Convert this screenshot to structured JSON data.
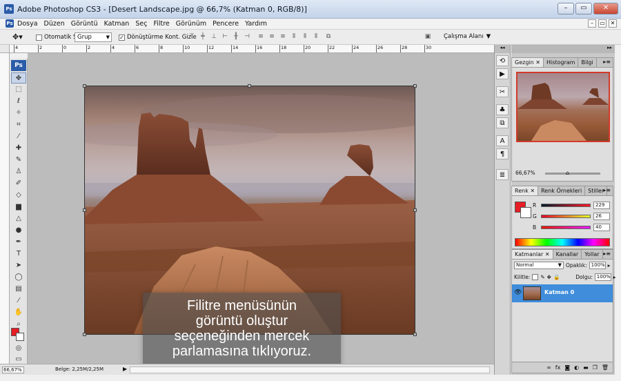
{
  "window": {
    "title": "Adobe Photoshop CS3 - [Desert Landscape.jpg @ 66,7% (Katman 0, RGB/8)]",
    "app_logo": "Ps"
  },
  "menu": [
    "Dosya",
    "Düzen",
    "Görüntü",
    "Katman",
    "Seç",
    "Filtre",
    "Görünüm",
    "Pencere",
    "Yardım"
  ],
  "options": {
    "auto_select_label": "Otomatik Seç:",
    "auto_select_value": "Grup",
    "transform_label": "Dönüştürme Kont. Gizle",
    "workspace_label": "Çalışma Alanı"
  },
  "ruler": [
    "4",
    "2",
    "0",
    "2",
    "4",
    "6",
    "8",
    "10",
    "12",
    "14",
    "16",
    "18",
    "20",
    "22",
    "24",
    "26",
    "28",
    "30"
  ],
  "status": {
    "zoom": "66,67%",
    "doc_size": "Belge: 2,25M/2,25M"
  },
  "panels": {
    "nav_tabs": [
      "Gezgin",
      "Histogram",
      "Bilgi"
    ],
    "nav_zoom": "66,67%",
    "color_tabs": [
      "Renk",
      "Renk Örnekleri",
      "Stiller"
    ],
    "color": {
      "r": "229",
      "g": "26",
      "b": "40",
      "r_label": "R",
      "g_label": "G",
      "b_label": "B",
      "fg_hex": "#e51d24"
    },
    "layer_tabs": [
      "Katmanlar",
      "Kanallar",
      "Yollar"
    ],
    "blend_mode": "Normal",
    "opacity_label": "Opaklık:",
    "opacity_value": "100%",
    "lock_label": "Kilitle:",
    "fill_label": "Dolgu:",
    "fill_value": "100%",
    "layer_name": "Katman 0"
  },
  "caption": [
    "Filitre menüsünün",
    "görüntü oluştur",
    "seçeneğinden mercek",
    "parlamasına tıklıyoruz."
  ],
  "colors": {
    "layer_selected": "#3f8ddb",
    "titlebar": "#c3d3ea"
  }
}
